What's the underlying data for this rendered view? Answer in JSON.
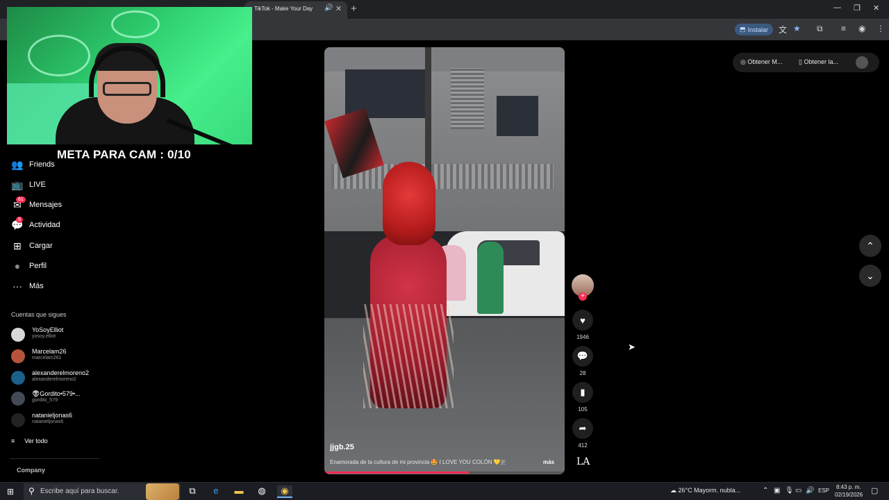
{
  "browser": {
    "tab_title": "TikTok - Make Your Day",
    "tab_audio_icon": "🔊",
    "tab_close": "✕",
    "new_tab": "+",
    "install_label": "Instalar"
  },
  "overlay": {
    "meta_text": "META PARA CAM : 0/10"
  },
  "sidebar": {
    "items": [
      {
        "label": "Friends",
        "icon": "friends-icon",
        "glyph": "👥"
      },
      {
        "label": "LIVE",
        "icon": "live-icon",
        "glyph": "📺"
      },
      {
        "label": "Mensajes",
        "icon": "messages-icon",
        "glyph": "✉",
        "badge": "61"
      },
      {
        "label": "Actividad",
        "icon": "activity-icon",
        "glyph": "💬",
        "badge": "9"
      },
      {
        "label": "Cargar",
        "icon": "upload-icon",
        "glyph": "⊞"
      },
      {
        "label": "Perfil",
        "icon": "profile-icon",
        "glyph": "●"
      },
      {
        "label": "Más",
        "icon": "more-icon",
        "glyph": "···"
      }
    ],
    "following_title": "Cuentas que sigues",
    "following": [
      {
        "name": "YoSoyElliot",
        "user": "yosoy.elliot",
        "color": "#d8d8d8"
      },
      {
        "name": "Marcelam26",
        "user": "marcelam261",
        "color": "#b5533c"
      },
      {
        "name": "alexanderelmoreno2",
        "user": "alexanderelmoreno2",
        "color": "#1c5f8a"
      },
      {
        "name": "👽Gordito•579•...",
        "user": "gordito_579",
        "color": "#444a55"
      },
      {
        "name": "natanieljonas6",
        "user": "natanieljonas6",
        "color": "#222222"
      }
    ],
    "see_all": "Ver todo",
    "see_all_glyph": "≡",
    "company": "Company"
  },
  "video": {
    "username": "jjgb.25",
    "caption": "Enamorada de la cultura de mi provincia 🤩 I LOVE YOU COLÓN 💛🇵",
    "more": "más",
    "progress_fraction": 0.6
  },
  "actions": {
    "likes": "1946",
    "comments": "28",
    "saves": "105",
    "shares": "412",
    "follow_plus": "+",
    "logo": "LA"
  },
  "right_top": {
    "btn1": "Obtener M...",
    "btn2": "Obtener la..."
  },
  "taskbar": {
    "search_placeholder": "Escribe aquí para buscar.",
    "weather": "26°C  Mayorm. nubla...",
    "lang": "ESP",
    "time": "8:43 p. m.",
    "date": "02/19/2026"
  }
}
